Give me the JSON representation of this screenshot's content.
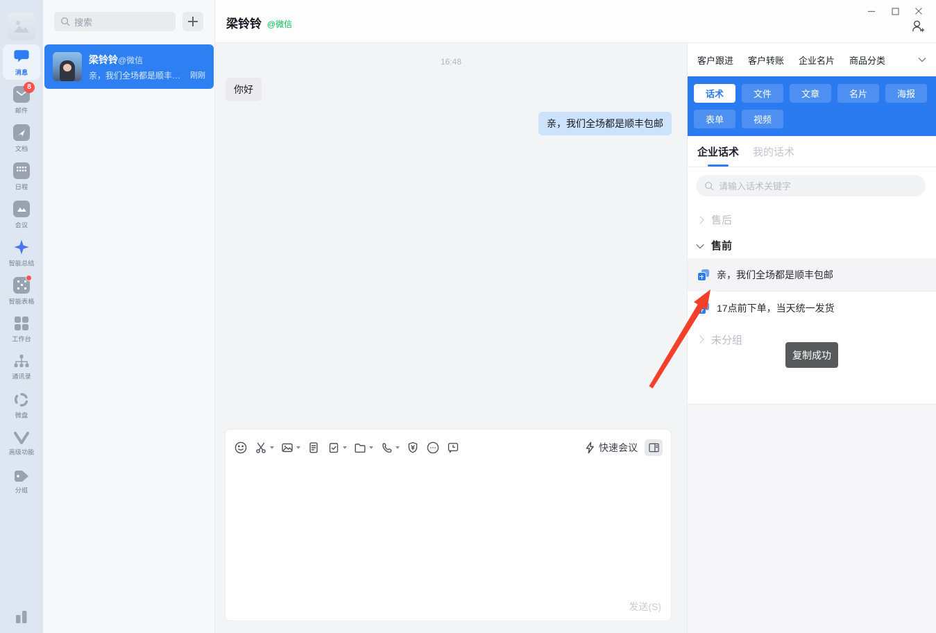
{
  "window": {
    "controls": [
      "minimize",
      "maximize",
      "close"
    ]
  },
  "colors": {
    "accent_blue": "#2b7bf0",
    "selected_conv": "#2e7ff2",
    "badge_red": "#fa5151",
    "wechat_green": "#09bb52",
    "tooltip_bg": "#58595b",
    "arrow_red": "#f3402b"
  },
  "sidebar": {
    "mail_badge": "8",
    "items": [
      {
        "label": "消息"
      },
      {
        "label": "邮件"
      },
      {
        "label": "文档"
      },
      {
        "label": "日程"
      },
      {
        "label": "会议"
      },
      {
        "label": "智能总结"
      },
      {
        "label": "智能表格"
      },
      {
        "label": "工作台"
      },
      {
        "label": "通讯录"
      },
      {
        "label": "微盘"
      },
      {
        "label": "高级功能"
      },
      {
        "label": "分组"
      }
    ]
  },
  "chat_list": {
    "search_placeholder": "搜索",
    "conversation": {
      "name": "梁铃铃",
      "tag": "@微信",
      "preview": "亲，我们全场都是顺丰…",
      "time": "刚刚"
    }
  },
  "chat": {
    "title": "梁铃铃",
    "title_tag": "@微信",
    "timestamp": "16:48",
    "messages": [
      {
        "dir": "in",
        "text": "你好"
      },
      {
        "dir": "out",
        "text": "亲，我们全场都是顺丰包邮"
      }
    ],
    "composer": {
      "quick_meeting": "快速会议",
      "send_label": "发送(S)"
    }
  },
  "right_panel": {
    "tabs": [
      "客户跟进",
      "客户转账",
      "企业名片",
      "商品分类"
    ],
    "categories": [
      "话术",
      "文件",
      "文章",
      "名片",
      "海报",
      "表单",
      "视频"
    ],
    "active_category": "话术",
    "sub_tabs": [
      "企业话术",
      "我的话术"
    ],
    "active_sub_tab": "企业话术",
    "search_placeholder": "请输入话术关键字",
    "groups": [
      {
        "label": "售后",
        "expanded": false,
        "items": []
      },
      {
        "label": "售前",
        "expanded": true,
        "items": [
          "亲，我们全场都是顺丰包邮",
          "17点前下单，当天统一发货"
        ]
      },
      {
        "label": "未分组",
        "expanded": false,
        "items": []
      }
    ],
    "tooltip": "复制成功"
  }
}
